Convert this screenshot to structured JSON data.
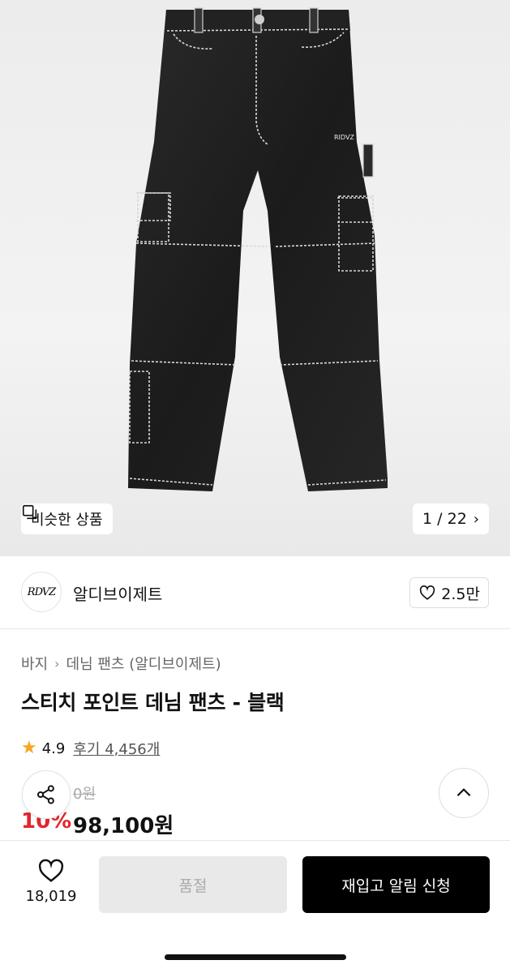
{
  "gallery": {
    "similar_label": "비슷한 상품",
    "pager_text": "1 / 22",
    "logo_on_image": "RIDVZ"
  },
  "brand": {
    "logo_text": "RDVZ",
    "name": "알디브이제트",
    "like_count": "2.5만"
  },
  "product": {
    "breadcrumb": [
      "바지",
      "데님 팬츠 (알디브이제트)"
    ],
    "title": "스티치 포인트 데님 팬츠 - 블랙",
    "rating": "4.9",
    "reviews": "후기 4,456개",
    "original_price": "0원",
    "discount": "10%",
    "price": "98,100원"
  },
  "bottom_bar": {
    "wish_count": "18,019",
    "soldout_label": "품절",
    "restock_label": "재입고 알림 신청"
  },
  "colors": {
    "accent_red": "#e2262c",
    "star": "#f5a623",
    "primary_button": "#000000"
  }
}
